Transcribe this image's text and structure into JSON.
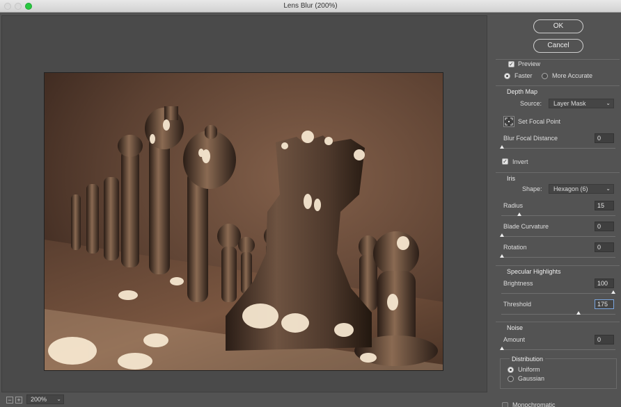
{
  "window": {
    "title": "Lens Blur (200%)"
  },
  "bottom": {
    "zoom": "200%",
    "zoom_out": "−",
    "zoom_in": "+"
  },
  "buttons": {
    "ok": "OK",
    "cancel": "Cancel"
  },
  "preview": {
    "label": "Preview",
    "checked": true,
    "faster": "Faster",
    "more_accurate": "More Accurate",
    "mode": "Faster"
  },
  "depth_map": {
    "heading": "Depth Map",
    "source_label": "Source:",
    "source_value": "Layer Mask",
    "set_focal_point": "Set Focal Point",
    "blur_focal_distance_label": "Blur Focal Distance",
    "blur_focal_distance": "0",
    "invert_label": "Invert",
    "invert_checked": true
  },
  "iris": {
    "heading": "Iris",
    "shape_label": "Shape:",
    "shape_value": "Hexagon (6)",
    "radius_label": "Radius",
    "radius": "15",
    "blade_label": "Blade Curvature",
    "blade": "0",
    "rotation_label": "Rotation",
    "rotation": "0"
  },
  "specular": {
    "heading": "Specular Highlights",
    "brightness_label": "Brightness",
    "brightness": "100",
    "threshold_label": "Threshold",
    "threshold": "175"
  },
  "noise": {
    "heading": "Noise",
    "amount_label": "Amount",
    "amount": "0",
    "distribution_heading": "Distribution",
    "uniform": "Uniform",
    "gaussian": "Gaussian",
    "distribution": "Uniform",
    "monochromatic": "Monochromatic",
    "monochromatic_checked": false
  },
  "colors": {
    "panel_bg": "#535353",
    "focus_ring": "#7aa6e0",
    "close_green": "#28c840"
  }
}
